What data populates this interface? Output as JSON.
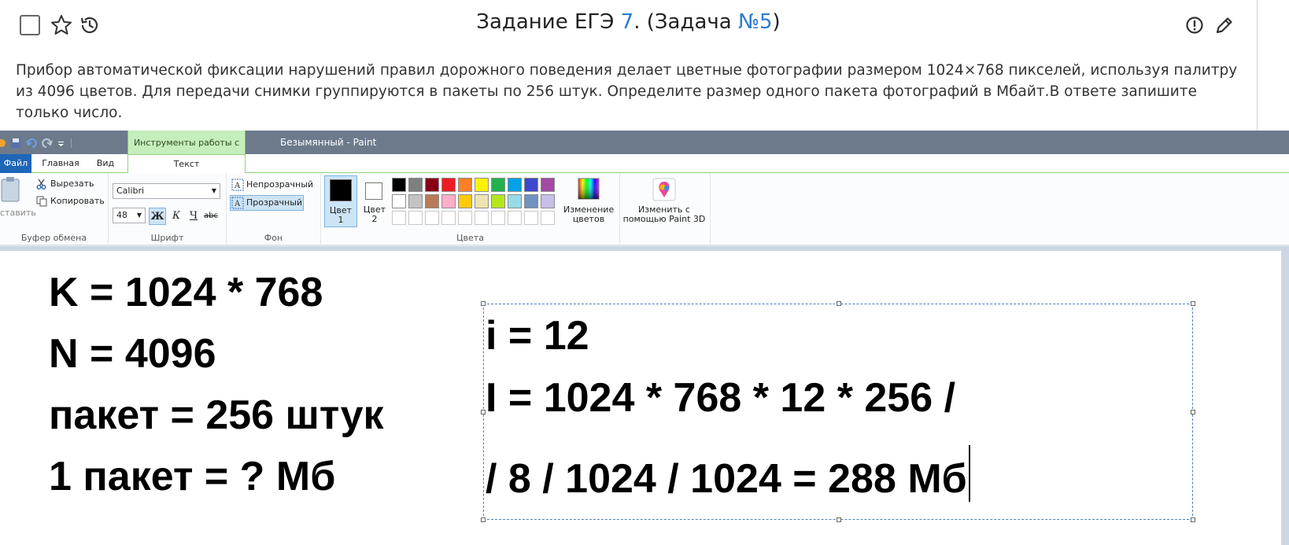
{
  "task": {
    "title_prefix": "Задание ЕГЭ ",
    "title_num": "7",
    "title_mid": ". (Задача ",
    "title_link": "№5",
    "title_suffix": ")",
    "description": "Прибор автоматической фиксации нарушений правил дорожного поведения делает цветные фотографии размером 1024×768 пикселей, используя палитру из 4096 цветов. Для передачи снимки группируются в пакеты по 256 штук. Определите размер одного пакета фотографий в Мбайт.В ответе запишите только число."
  },
  "paint": {
    "contextual_tab": "Инструменты работы с текстом",
    "window_title": "Безымянный - Paint",
    "tabs": {
      "file": "Файл",
      "home": "Главная",
      "view": "Вид",
      "text": "Текст"
    },
    "clipboard": {
      "paste": "ставить",
      "cut": "Вырезать",
      "copy": "Копировать",
      "label": "Буфер обмена"
    },
    "font": {
      "family": "Calibri",
      "size": "48",
      "bold": "Ж",
      "italic": "К",
      "underline": "Ч",
      "strike": "abc",
      "label": "Шрифт"
    },
    "background": {
      "opaque": "Непрозрачный",
      "transparent": "Прозрачный",
      "label": "Фон"
    },
    "colors": {
      "color1_label": "Цвет",
      "color1_num": "1",
      "color2_label": "Цвет",
      "color2_num": "2",
      "edit_line1": "Изменение",
      "edit_line2": "цветов",
      "label": "Цвета",
      "color1": "#000000",
      "color2": "#ffffff",
      "row1": [
        "#000000",
        "#7f7f7f",
        "#880015",
        "#ed1c24",
        "#ff7f27",
        "#fff200",
        "#22b14c",
        "#00a2e8",
        "#3f48cc",
        "#a349a4"
      ],
      "row2": [
        "#ffffff",
        "#c3c3c3",
        "#b97a57",
        "#ffaec9",
        "#ffc90e",
        "#efe4b0",
        "#b5e61d",
        "#99d9ea",
        "#7092be",
        "#c8bfe7"
      ],
      "row3": [
        "#ffffff",
        "#ffffff",
        "#ffffff",
        "#ffffff",
        "#ffffff",
        "#ffffff",
        "#ffffff",
        "#ffffff",
        "#ffffff",
        "#ffffff"
      ]
    },
    "paint3d": {
      "line1": "Изменить с",
      "line2": "помощью Paint 3D"
    }
  },
  "canvas": {
    "left_lines": [
      "K = 1024 * 768",
      "N = 4096",
      "пакет = 256 штук",
      "1 пакет = ? Мб"
    ],
    "right_lines": [
      "i = 12",
      "I = 1024 * 768 * 12 * 256 /",
      "/ 8 / 1024 / 1024 = 288 Мб"
    ]
  }
}
